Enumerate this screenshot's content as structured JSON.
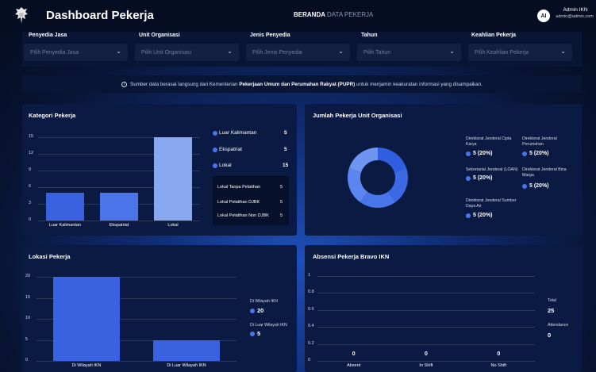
{
  "header": {
    "title": "Dashboard Pekerja",
    "nav": [
      "BERANDA",
      "DATA PEKERJA"
    ],
    "user": {
      "initials": "AI",
      "name": "Admin IKN",
      "email": "admin@admin.com"
    }
  },
  "filters": [
    {
      "label": "Penyedia Jasa",
      "placeholder": "Pilih Penyedia Jasa"
    },
    {
      "label": "Unit Organisasi",
      "placeholder": "Pilih Unit Organisasi"
    },
    {
      "label": "Jenis Penyedia",
      "placeholder": "Pilih Jenis Penyedia"
    },
    {
      "label": "Tahun",
      "placeholder": "Pilih Tahun"
    },
    {
      "label": "Keahlian Pekerja",
      "placeholder": "Pilih Keahlian Pekerja"
    }
  ],
  "banner": {
    "icon": "info-icon",
    "prefix": "Sumber data berasal langsung dari Kementerian",
    "bold": "Pekerjaan Umum dan Perumahan Rakyat (PUPR)",
    "suffix": "untuk menjamin keakuratan informasi yang disampaikan."
  },
  "kategori": {
    "title": "Kategori Pekerja",
    "legend": [
      {
        "label": "Luar Kalimantan",
        "value": "5"
      },
      {
        "label": "Ekspatriat",
        "value": "5"
      },
      {
        "label": "Lokal",
        "value": "15"
      }
    ],
    "sub": [
      {
        "label": "Lokal Tanpa Pelatihan",
        "value": "5"
      },
      {
        "label": "Lokal Pelatihan DJBK",
        "value": "5"
      },
      {
        "label": "Lokal Pelatihan Non DJBK",
        "value": "5"
      }
    ]
  },
  "unit": {
    "title": "Jumlah Pekerja Unit Organisasi",
    "items": [
      {
        "label": "Direktorat Jenderal Cipta Karya",
        "value": "5 (20%)"
      },
      {
        "label": "Direktorat Jenderal Perumahan",
        "value": "5 (20%)"
      },
      {
        "label": "Sekretariat Jenderal (LOAN)",
        "value": "5 (20%)"
      },
      {
        "label": "Direktorat Jenderal Bina Marga",
        "value": "5 (20%)"
      },
      {
        "label": "Direktorat Jenderal Sumber Daya Air",
        "value": "5 (20%)"
      }
    ]
  },
  "lokasi": {
    "title": "Lokasi Pekerja",
    "legend": [
      {
        "label": "Di Wilayah IKN",
        "value": "20"
      },
      {
        "label": "Di Luar Wilayah IKN",
        "value": "5"
      }
    ]
  },
  "absensi": {
    "title": "Absensi Pekerja Bravo IKN",
    "side": [
      {
        "label": "Total",
        "value": "25"
      },
      {
        "label": "Attendance",
        "value": "0"
      }
    ]
  },
  "chart_data": [
    {
      "type": "bar",
      "title": "Kategori Pekerja",
      "categories": [
        "Luar Kalimantan",
        "Ekspatriat",
        "Lokal"
      ],
      "values": [
        5,
        5,
        15
      ],
      "ylim": [
        0,
        15
      ],
      "yticks": [
        0,
        3,
        6,
        9,
        12,
        15
      ],
      "colors": [
        "#3a62e0",
        "#4a74e8",
        "#8aa8f0"
      ]
    },
    {
      "type": "pie",
      "title": "Jumlah Pekerja Unit Organisasi",
      "categories": [
        "Direktorat Jenderal Cipta Karya",
        "Direktorat Jenderal Perumahan",
        "Sekretariat Jenderal (LOAN)",
        "Direktorat Jenderal Bina Marga",
        "Direktorat Jenderal Sumber Daya Air"
      ],
      "values": [
        5,
        5,
        5,
        5,
        5
      ],
      "colors": [
        "#2f5fe0",
        "#3c6ae6",
        "#4a76eb",
        "#5c86ef",
        "#6f95f2"
      ]
    },
    {
      "type": "bar",
      "title": "Lokasi Pekerja",
      "categories": [
        "Di Wilayah IKN",
        "Di Luar Wilayah IKN"
      ],
      "values": [
        20,
        5
      ],
      "ylim": [
        0,
        20
      ],
      "yticks": [
        0,
        5,
        10,
        15,
        20
      ]
    },
    {
      "type": "bar",
      "title": "Absensi Pekerja Bravo IKN",
      "categories": [
        "Absent",
        "In Shift",
        "No Shift"
      ],
      "values": [
        0,
        0,
        0
      ],
      "ylim": [
        0,
        1
      ],
      "yticks": [
        0,
        0.2,
        0.4,
        0.6,
        0.8,
        1
      ]
    }
  ]
}
